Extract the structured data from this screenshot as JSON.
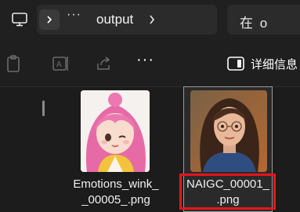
{
  "addressbar": {
    "more_label": "···",
    "crumb": "output"
  },
  "search": {
    "text": "在 o"
  },
  "toolbar": {
    "more_label": "···",
    "details_label": "详细信息"
  },
  "files": [
    {
      "name_line1": "Emotions_wink_",
      "name_line2": "_00005_.png"
    },
    {
      "name_line1": "NAIGC_00001_",
      "name_line2": ".png"
    }
  ],
  "colors": {
    "background": "#1c1c1c",
    "highlight_box": "#e8141b"
  }
}
